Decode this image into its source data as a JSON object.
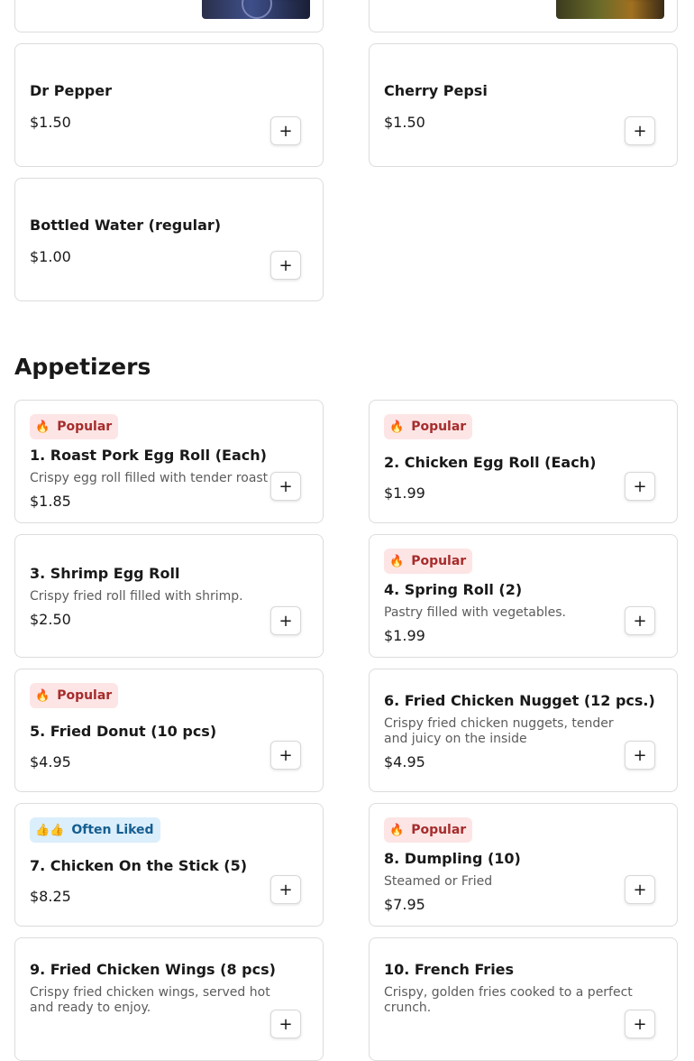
{
  "top_cards": {
    "add_label": "+"
  },
  "drinks": [
    {
      "name": "Dr Pepper",
      "price": "$1.50"
    },
    {
      "name": "Cherry Pepsi",
      "price": "$1.50"
    },
    {
      "name": "Bottled Water (regular)",
      "price": "$1.00"
    }
  ],
  "appetizers": {
    "title": "Appetizers",
    "add_label": "+",
    "items": [
      {
        "badge": "Popular",
        "badge_icon": "🔥",
        "name": "1. Roast Pork Egg Roll (Each)",
        "desc": "Crispy egg roll filled with tender roast",
        "price": "$1.85"
      },
      {
        "badge": "Popular",
        "badge_icon": "🔥",
        "name": "2. Chicken Egg Roll (Each)",
        "desc": "",
        "price": "$1.99"
      },
      {
        "badge": "",
        "name": "3. Shrimp Egg Roll",
        "desc": "Crispy fried roll filled with shrimp.",
        "price": "$2.50"
      },
      {
        "badge": "Popular",
        "badge_icon": "🔥",
        "name": "4. Spring Roll (2)",
        "desc": "Pastry filled with vegetables.",
        "price": "$1.99"
      },
      {
        "badge": "Popular",
        "badge_icon": "🔥",
        "name": "5. Fried Donut (10 pcs)",
        "desc": "",
        "price": "$4.95"
      },
      {
        "badge": "",
        "name": "6. Fried Chicken Nugget (12 pcs.)",
        "desc": "Crispy fried chicken nuggets, tender and juicy on the inside",
        "price": "$4.95"
      },
      {
        "badge": "Often Liked",
        "badge_icon": "👍👍",
        "name": "7. Chicken On the Stick (5)",
        "desc": "",
        "price": "$8.25"
      },
      {
        "badge": "Popular",
        "badge_icon": "🔥",
        "name": "8. Dumpling (10)",
        "desc": "Steamed or Fried",
        "price": "$7.95"
      },
      {
        "badge": "",
        "name": "9. Fried Chicken Wings (8 pcs)",
        "desc": "Crispy fried chicken wings, served hot and ready to enjoy.",
        "price": ""
      },
      {
        "badge": "",
        "name": "10. French Fries",
        "desc": "Crispy, golden fries cooked to a perfect crunch.",
        "price": ""
      }
    ]
  },
  "colors": {
    "popular_bg": "#fde5e5",
    "popular_text": "#a62c2c",
    "liked_bg": "#dbeefb",
    "liked_text": "#155e91",
    "border": "#dcdcdc"
  }
}
